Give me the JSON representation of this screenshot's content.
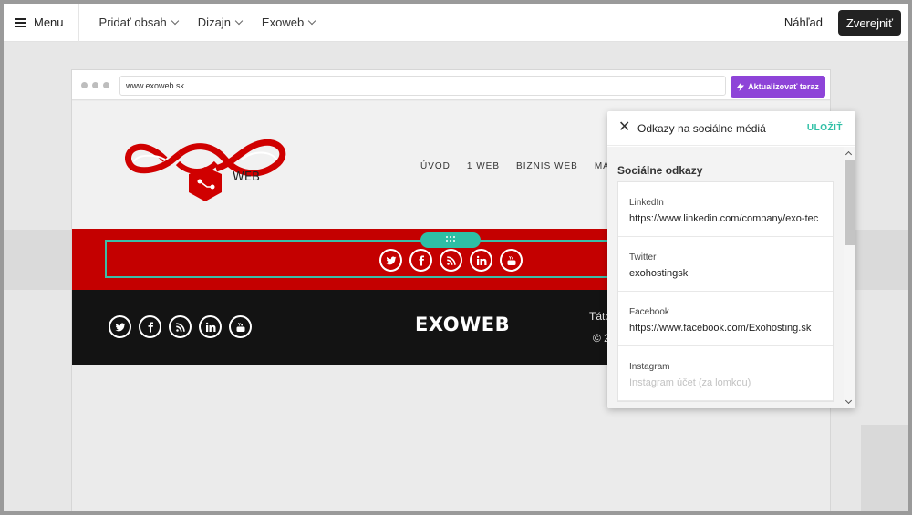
{
  "topbar": {
    "menu_label": "Menu",
    "nav": [
      {
        "label": "Pridať obsah"
      },
      {
        "label": "Dizajn"
      },
      {
        "label": "Exoweb"
      }
    ],
    "preview_label": "Náhľad",
    "publish_label": "Zverejniť"
  },
  "browser": {
    "url": "www.exoweb.sk",
    "update_label": "Aktualizovať teraz"
  },
  "site": {
    "logo_text": "WEB",
    "nav": [
      "ÚVOD",
      "1 WEB",
      "BIZNIS WEB",
      "MA"
    ],
    "footer_brand": "EXOWEB",
    "footer_text1": "Táto",
    "footer_text2": "© 2"
  },
  "social_icons": [
    "twitter-icon",
    "facebook-icon",
    "rss-icon",
    "linkedin-icon",
    "youtube-icon"
  ],
  "panel": {
    "title": "Odkazy na sociálne médiá",
    "save_label": "ULOŽIŤ",
    "section_label": "Sociálne odkazy",
    "fields": [
      {
        "label": "LinkedIn",
        "value": "https://www.linkedin.com/company/exo-tec",
        "placeholder": ""
      },
      {
        "label": "Twitter",
        "value": "exohostingsk",
        "placeholder": ""
      },
      {
        "label": "Facebook",
        "value": "https://www.facebook.com/Exohosting.sk",
        "placeholder": ""
      },
      {
        "label": "Instagram",
        "value": "",
        "placeholder": "Instagram účet (za lomkou)"
      }
    ]
  },
  "colors": {
    "accent": "#2ebfa5",
    "update_button": "#8e44d8",
    "brand_red": "#c40000",
    "footer_bg": "#131313"
  }
}
